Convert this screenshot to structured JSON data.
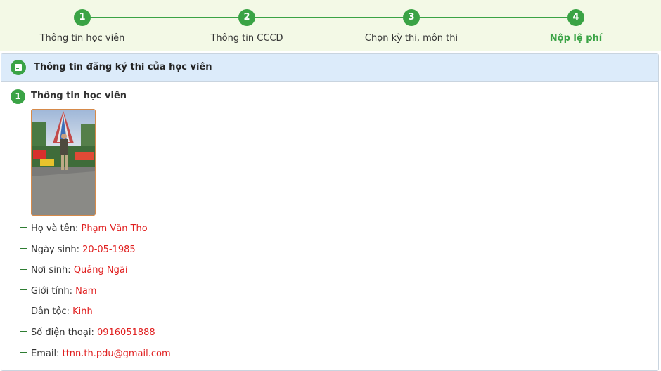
{
  "steps": [
    {
      "number": "1",
      "label": "Thông tin học viên"
    },
    {
      "number": "2",
      "label": "Thông tin CCCD"
    },
    {
      "number": "3",
      "label": "Chọn kỳ thi, môn thi"
    },
    {
      "number": "4",
      "label": "Nộp lệ phí"
    }
  ],
  "active_step": 4,
  "panel": {
    "title": "Thông tin đăng ký thi của học viên",
    "icon": "document-icon"
  },
  "section": {
    "number": "1",
    "title": "Thông tin học viên"
  },
  "student": {
    "photo_alt": "Ảnh học viên",
    "fields": [
      {
        "label": "Họ và tên:",
        "value": "Phạm Văn Tho"
      },
      {
        "label": "Ngày sinh:",
        "value": "20-05-1985"
      },
      {
        "label": "Nơi sinh:",
        "value": "Quảng Ngãi"
      },
      {
        "label": "Giới tính:",
        "value": "Nam"
      },
      {
        "label": "Dân tộc:",
        "value": "Kinh"
      },
      {
        "label": "Số điện thoại:",
        "value": "0916051888"
      },
      {
        "label": "Email:",
        "value": "ttnn.th.pdu@gmail.com"
      }
    ]
  },
  "colors": {
    "accent": "#3aa345",
    "value_text": "#e02020",
    "header_bg": "#dcebfa",
    "stepper_bg": "#f3f9e6",
    "tree_line": "#2e7d32"
  }
}
